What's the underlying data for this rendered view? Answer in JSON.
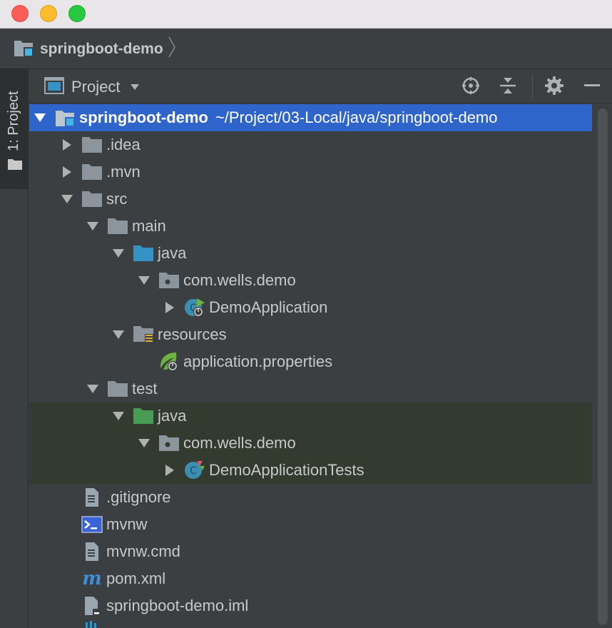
{
  "breadcrumb": {
    "label": "springboot-demo"
  },
  "toolstrip": {
    "tab_label": "1: Project"
  },
  "project_panel": {
    "title": "Project"
  },
  "tree": [
    {
      "label": "springboot-demo",
      "path": "~/Project/03-Local/java/springboot-demo"
    },
    {
      "label": ".idea"
    },
    {
      "label": ".mvn"
    },
    {
      "label": "src"
    },
    {
      "label": "main"
    },
    {
      "label": "java"
    },
    {
      "label": "com.wells.demo"
    },
    {
      "label": "DemoApplication"
    },
    {
      "label": "resources"
    },
    {
      "label": "application.properties"
    },
    {
      "label": "test"
    },
    {
      "label": "java"
    },
    {
      "label": "com.wells.demo"
    },
    {
      "label": "DemoApplicationTests"
    },
    {
      "label": ".gitignore"
    },
    {
      "label": "mvnw"
    },
    {
      "label": "mvnw.cmd"
    },
    {
      "label": "pom.xml"
    },
    {
      "label": "springboot-demo.iml"
    }
  ],
  "colors": {
    "selection": "#2f65ca",
    "source_root": "#3592c4",
    "test_root": "#499c54",
    "test_row_bg": "#333a30",
    "spring_green": "#6db33f"
  }
}
